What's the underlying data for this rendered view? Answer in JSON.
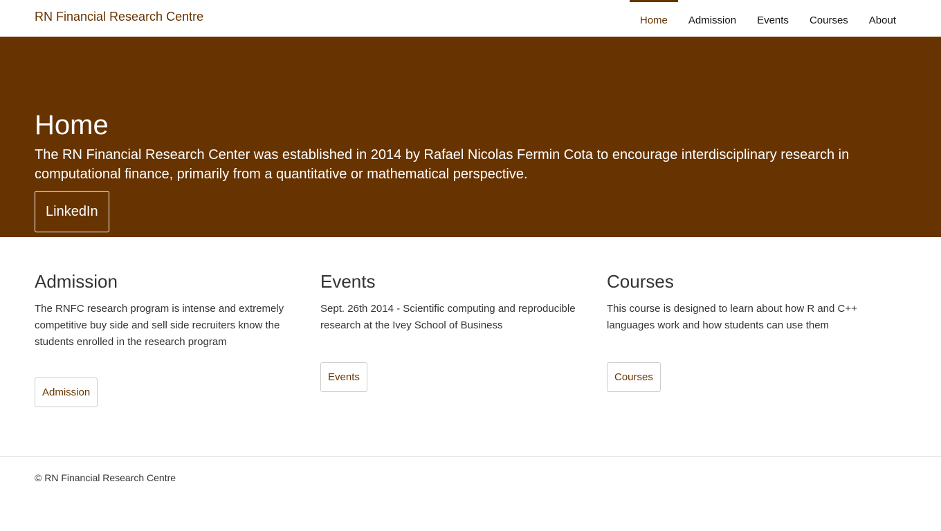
{
  "header": {
    "brand": "RN Financial Research Centre",
    "nav": [
      {
        "label": "Home",
        "active": true
      },
      {
        "label": "Admission",
        "active": false
      },
      {
        "label": "Events",
        "active": false
      },
      {
        "label": "Courses",
        "active": false
      },
      {
        "label": "About",
        "active": false
      }
    ]
  },
  "hero": {
    "title": "Home",
    "text": "The RN Financial Research Center was established in 2014 by Rafael Nicolas Fermin Cota to encourage interdisciplinary research in computational finance, primarily from a quantitative or mathematical perspective.",
    "button_label": "LinkedIn"
  },
  "cards": [
    {
      "title": "Admission",
      "text": "The RNFC research program is intense and extremely competitive buy side and sell side recruiters know the students enrolled in the research program",
      "button_label": "Admission"
    },
    {
      "title": "Events",
      "text": "Sept. 26th 2014 - Scientific computing and reproducible research at the Ivey School of Business",
      "button_label": "Events"
    },
    {
      "title": "Courses",
      "text": "This course is designed to learn about how R and C++ languages work and how students can use them",
      "button_label": "Courses"
    }
  ],
  "footer": {
    "text": "© RN Financial Research Centre"
  },
  "colors": {
    "brand": "#673300",
    "background": "#ffffff",
    "text": "#333333",
    "border": "#cccccc"
  }
}
